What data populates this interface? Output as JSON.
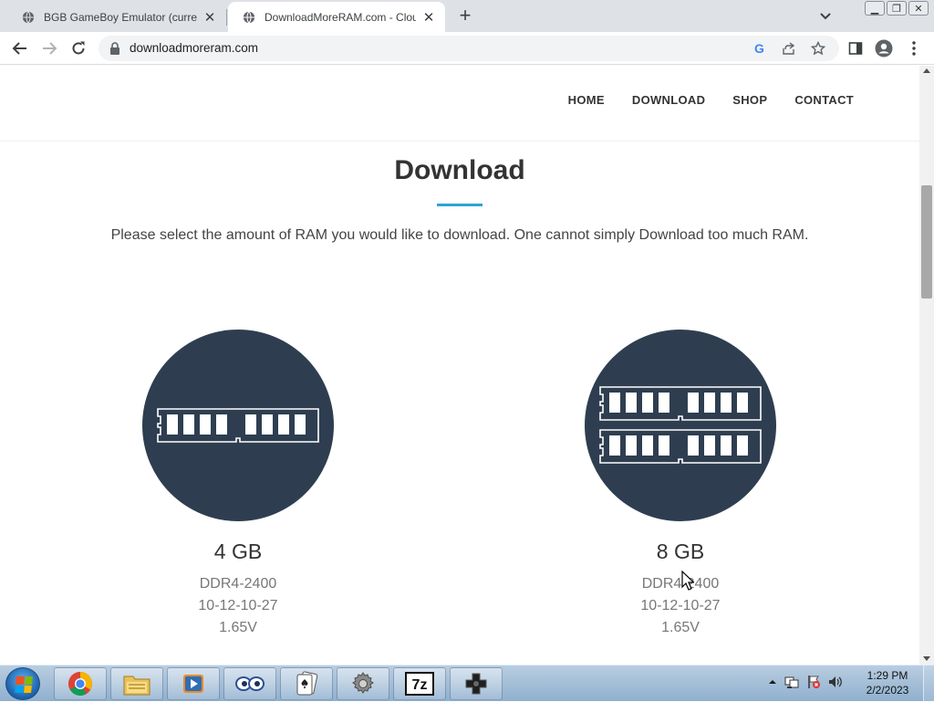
{
  "browser": {
    "tabs": [
      {
        "title": "BGB GameBoy Emulator (current",
        "active": false
      },
      {
        "title": "DownloadMoreRAM.com - Clou",
        "active": true
      }
    ],
    "new_tab_symbol": "+",
    "url": "downloadmoreram.com",
    "window_controls": [
      "minimize",
      "restore",
      "close"
    ]
  },
  "site": {
    "nav": [
      "HOME",
      "DOWNLOAD",
      "SHOP",
      "CONTACT"
    ],
    "page_title": "Download",
    "intro": "Please select the amount of RAM you would like to download. One cannot simply Download too much RAM.",
    "products": [
      {
        "capacity": "4 GB",
        "type": "DDR4-2400",
        "timings": "10-12-10-27",
        "voltage": "1.65V",
        "modules": 1
      },
      {
        "capacity": "8 GB",
        "type": "DDR4-2400",
        "timings": "10-12-10-27",
        "voltage": "1.65V",
        "modules": 2
      }
    ],
    "colors": {
      "circle": "#2e3e50",
      "accent": "#2aa5d6"
    }
  },
  "taskbar": {
    "pinned": [
      "chrome-icon",
      "explorer-icon",
      "media-player-icon",
      "eyes-icon",
      "solitaire-icon",
      "settings-gear-icon",
      "7zip-icon",
      "gamepad-icon"
    ],
    "sevenzip_label": "7z",
    "tray_icons": [
      "show-hidden-icons",
      "network-icon",
      "action-center-icon",
      "volume-icon"
    ],
    "time": "1:29 PM",
    "date": "2/2/2023"
  }
}
